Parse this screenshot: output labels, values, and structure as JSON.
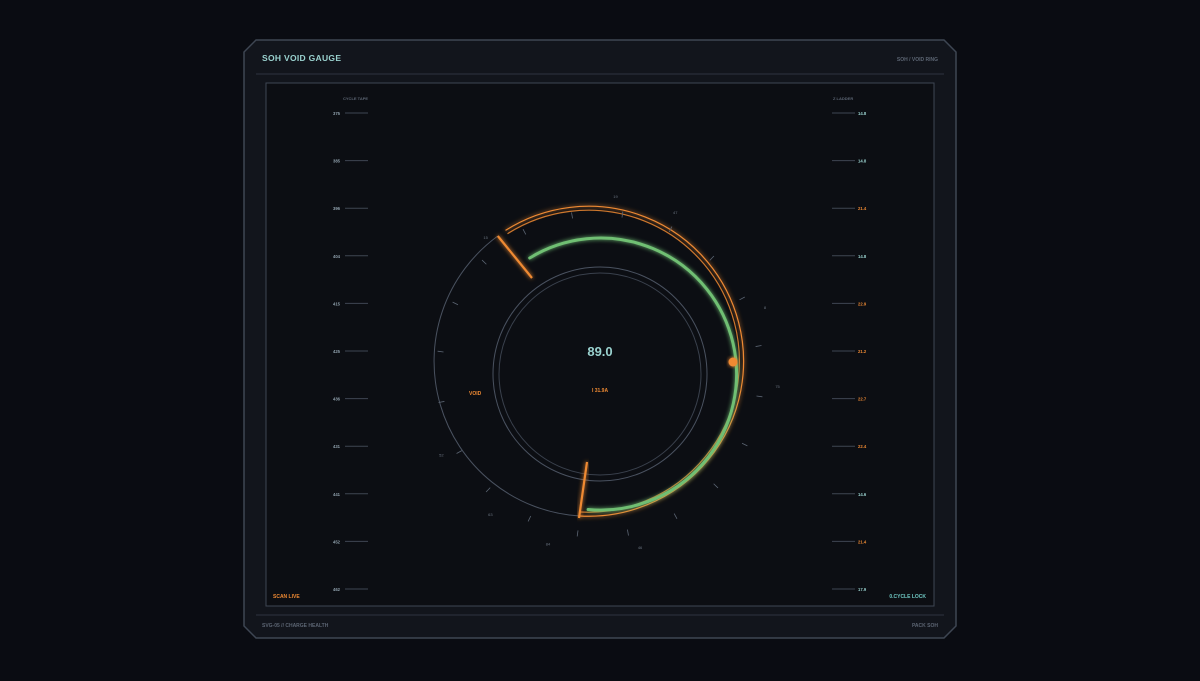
{
  "header": {
    "title": "SOH VOID GAUGE",
    "breadcrumb": "SOH  /  VOID RING"
  },
  "footer": {
    "left": "SVG-05  //  CHARGE HEALTH",
    "right": "PACK SOH"
  },
  "left_tape": {
    "label": "CYCLE TAPE",
    "ticks": [
      "375",
      "385",
      "396",
      "404",
      "415",
      "425",
      "436",
      "431",
      "441",
      "452",
      "462"
    ]
  },
  "right_ladder": {
    "label": "Z LADDER",
    "ticks": [
      {
        "text": "14.8",
        "status": "normal"
      },
      {
        "text": "14.8",
        "status": "normal"
      },
      {
        "text": "21.4",
        "status": "warn"
      },
      {
        "text": "14.8",
        "status": "normal"
      },
      {
        "text": "22.9",
        "status": "warn"
      },
      {
        "text": "21.2",
        "status": "warn"
      },
      {
        "text": "22.7",
        "status": "warn"
      },
      {
        "text": "22.4",
        "status": "warn"
      },
      {
        "text": "14.6",
        "status": "normal"
      },
      {
        "text": "21.4",
        "status": "warn"
      },
      {
        "text": "17.9",
        "status": "normal"
      }
    ]
  },
  "gauge": {
    "value": "89.0",
    "void_label": "VOID",
    "sub_readout": "I  31.9A",
    "ring_labels": [
      "15",
      "19",
      "47",
      "75",
      "46",
      "84",
      "63",
      "52",
      "8"
    ]
  },
  "status": {
    "left": "SCAN LIVE",
    "right": "0.CYCLE LOCK"
  },
  "colors": {
    "background": "#0a0c12",
    "panel": "#12151c",
    "accent_orange": "#ef8a33",
    "accent_green": "#6fbf73",
    "text_teal": "#9ad2cf",
    "muted": "#5c6573"
  }
}
